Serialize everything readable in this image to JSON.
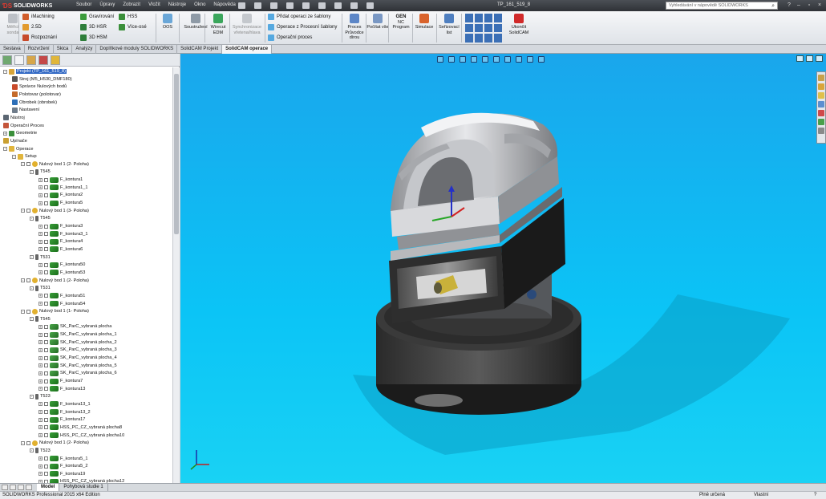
{
  "app": {
    "logo_text": "SOLIDWORKS",
    "document_title": "TP_161_519_8",
    "search_placeholder": "Vyhledávání v nápovědě SOLIDWORKS"
  },
  "menu": [
    "Soubor",
    "Úpravy",
    "Zobrazit",
    "Vložit",
    "Nástroje",
    "Okno",
    "Nápověda"
  ],
  "ribbon": {
    "measure_label": "Měřicí sonda",
    "imachining": "iMachining",
    "d25": "2.5D",
    "rozpoznani": "Rozpoznání",
    "gravirovani": "Gravírování",
    "hsr": "3D HSR",
    "hsm": "3D HSM",
    "hss": "HSS",
    "viceose": "Více-osé",
    "oos": "OOS",
    "soustruzeni": "Soustružení",
    "wirecut": "Wirecut EDM",
    "synchro": "Synchronizace vřetena/hlava",
    "pridat": "Přidat operaci ze šablony",
    "zprocesni": "Operace z Procesní šablony",
    "operacni_proces": "Operační proces",
    "proces_pruvodce": "Proces Průvodce dírou",
    "pocitat": "Počítat vše",
    "gen": "GEN",
    "nc": "NC Program",
    "simulace": "Simulace",
    "serizovaci": "Seřizovací list",
    "ukoncit": "Ukončit SolidCAM"
  },
  "tabs": [
    {
      "label": "Sestava",
      "active": false
    },
    {
      "label": "Rozvržení",
      "active": false
    },
    {
      "label": "Skica",
      "active": false
    },
    {
      "label": "Analýzy",
      "active": false
    },
    {
      "label": "Doplňkové moduly SOLIDWORKS",
      "active": false
    },
    {
      "label": "SolidCAM Projekt",
      "active": false
    },
    {
      "label": "SolidCAM operace",
      "active": true
    }
  ],
  "tree": [
    {
      "text": "Projekt (TP_161_519_8)",
      "level": 0,
      "expander": "-",
      "icon": "project",
      "sel": true
    },
    {
      "text": "Stroj (M5_H530_DMF180)",
      "level": 1,
      "icon": "machine"
    },
    {
      "text": "Správce Nulových bodů",
      "level": 1,
      "icon": "coord"
    },
    {
      "text": "Polotovar (polotovar)",
      "level": 1,
      "icon": "stock"
    },
    {
      "text": "Obrobek (obrobek)",
      "level": 1,
      "icon": "target"
    },
    {
      "text": "Nastavení",
      "level": 1,
      "icon": "settings"
    },
    {
      "text": "Nástroj",
      "level": 0,
      "icon": "tool-lib"
    },
    {
      "text": "Operační Proces",
      "level": 0,
      "icon": "process"
    },
    {
      "text": "Geometrie",
      "level": 0,
      "expander": "+",
      "icon": "geometry"
    },
    {
      "text": "Upínače",
      "level": 0,
      "icon": "fixture"
    },
    {
      "text": "Operace",
      "level": 0,
      "expander": "-",
      "icon": "folder"
    },
    {
      "text": "Setup",
      "level": 1,
      "expander": "-",
      "icon": "folder"
    },
    {
      "text": "Nulový bod 1 (2- Poloha)",
      "level": 2,
      "expander": "-",
      "icon": "setup",
      "check": true
    },
    {
      "text": "T545",
      "level": 3,
      "expander": "-",
      "icon": "tool"
    },
    {
      "text": "F_kontura1",
      "level": 4,
      "expander": "+",
      "icon": "op",
      "check": true
    },
    {
      "text": "F_kontura1_1",
      "level": 4,
      "expander": "+",
      "icon": "op",
      "check": true
    },
    {
      "text": "F_kontura2",
      "level": 4,
      "expander": "+",
      "icon": "op",
      "check": true
    },
    {
      "text": "F_kontura5",
      "level": 4,
      "expander": "+",
      "icon": "op",
      "check": true
    },
    {
      "text": "Nulový bod 1 (3- Poloha)",
      "level": 2,
      "expander": "-",
      "icon": "setup",
      "check": true
    },
    {
      "text": "T545",
      "level": 3,
      "expander": "-",
      "icon": "tool"
    },
    {
      "text": "F_kontura3",
      "level": 4,
      "expander": "+",
      "icon": "op",
      "check": true
    },
    {
      "text": "F_kontura3_1",
      "level": 4,
      "expander": "+",
      "icon": "op",
      "check": true
    },
    {
      "text": "F_kontura4",
      "level": 4,
      "expander": "+",
      "icon": "op",
      "check": true
    },
    {
      "text": "F_kontura6",
      "level": 4,
      "expander": "+",
      "icon": "op",
      "check": true
    },
    {
      "text": "T531",
      "level": 3,
      "expander": "-",
      "icon": "tool"
    },
    {
      "text": "F_kontura50",
      "level": 4,
      "expander": "+",
      "icon": "op",
      "check": true
    },
    {
      "text": "F_kontura53",
      "level": 4,
      "expander": "+",
      "icon": "op",
      "check": true
    },
    {
      "text": "Nulový bod 1 (2- Poloha)",
      "level": 2,
      "expander": "-",
      "icon": "setup",
      "check": true
    },
    {
      "text": "T531",
      "level": 3,
      "expander": "-",
      "icon": "tool"
    },
    {
      "text": "F_kontura51",
      "level": 4,
      "expander": "+",
      "icon": "op",
      "check": true
    },
    {
      "text": "F_kontura54",
      "level": 4,
      "expander": "+",
      "icon": "op",
      "check": true
    },
    {
      "text": "Nulový bod 1 (1- Poloha)",
      "level": 2,
      "expander": "-",
      "icon": "setup",
      "check": true
    },
    {
      "text": "T545",
      "level": 3,
      "expander": "-",
      "icon": "tool"
    },
    {
      "text": "SK_ParC_vybraná plocha",
      "level": 4,
      "expander": "+",
      "icon": "op2",
      "check": true
    },
    {
      "text": "SK_ParC_vybraná plocha_1",
      "level": 4,
      "expander": "+",
      "icon": "op2",
      "check": true
    },
    {
      "text": "SK_ParC_vybraná plocha_2",
      "level": 4,
      "expander": "+",
      "icon": "op2",
      "check": true
    },
    {
      "text": "SK_ParC_vybraná plocha_3",
      "level": 4,
      "expander": "+",
      "icon": "op2",
      "check": true
    },
    {
      "text": "SK_ParC_vybraná plocha_4",
      "level": 4,
      "expander": "+",
      "icon": "op2",
      "check": true
    },
    {
      "text": "SK_ParC_vybraná plocha_5",
      "level": 4,
      "expander": "+",
      "icon": "op2",
      "check": true
    },
    {
      "text": "SK_ParC_vybraná plocha_6",
      "level": 4,
      "expander": "+",
      "icon": "op2",
      "check": true
    },
    {
      "text": "F_kontura7",
      "level": 4,
      "expander": "+",
      "icon": "op",
      "check": true
    },
    {
      "text": "F_kontura13",
      "level": 4,
      "expander": "+",
      "icon": "op",
      "check": true
    },
    {
      "text": "T523",
      "level": 3,
      "expander": "-",
      "icon": "tool"
    },
    {
      "text": "F_kontura13_1",
      "level": 4,
      "expander": "+",
      "icon": "op",
      "check": true
    },
    {
      "text": "F_kontura13_2",
      "level": 4,
      "expander": "+",
      "icon": "op",
      "check": true
    },
    {
      "text": "F_kontura17",
      "level": 4,
      "expander": "+",
      "icon": "op",
      "check": true
    },
    {
      "text": "HSS_PC_CZ_vybraná plocha8",
      "level": 4,
      "expander": "+",
      "icon": "op",
      "check": true
    },
    {
      "text": "HSS_PC_CZ_vybraná plocha10",
      "level": 4,
      "expander": "+",
      "icon": "op",
      "check": true
    },
    {
      "text": "Nulový bod 1 (2- Poloha)",
      "level": 2,
      "expander": "-",
      "icon": "setup",
      "check": true
    },
    {
      "text": "T523",
      "level": 3,
      "expander": "-",
      "icon": "tool"
    },
    {
      "text": "F_kontura5_1",
      "level": 4,
      "expander": "+",
      "icon": "op",
      "check": true
    },
    {
      "text": "F_kontura5_2",
      "level": 4,
      "expander": "+",
      "icon": "op",
      "check": true
    },
    {
      "text": "F_kontura19",
      "level": 4,
      "expander": "+",
      "icon": "op",
      "check": true
    },
    {
      "text": "HSS_PC_CZ_vybraná plocha12",
      "level": 4,
      "expander": "+",
      "icon": "op",
      "check": true
    }
  ],
  "bottom_tabs": [
    {
      "label": "Model",
      "active": true
    },
    {
      "label": "Pohybová studie 1",
      "active": false
    }
  ],
  "status": {
    "left": "SOLIDWORKS Professional 2015 x64 Edition",
    "defined": "Plně určená",
    "units": "Vlastní"
  },
  "colors": {
    "viewport_top": "#1aa6ec",
    "viewport_bottom": "#19d2f4",
    "selection": "#3168c4",
    "operation_icon": "#2f8f2f"
  }
}
